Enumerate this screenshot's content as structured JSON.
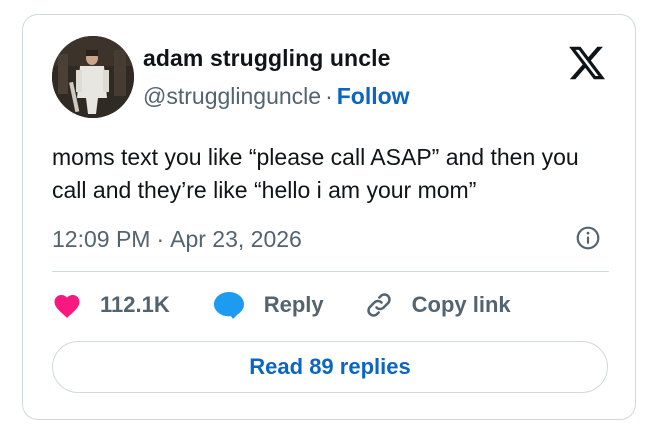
{
  "tweet": {
    "author_name": "adam struggling uncle",
    "author_handle": "@strugglinguncle",
    "separator": "·",
    "follow_label": "Follow",
    "text": "moms text you like “please call ASAP” and then you call and they’re like “hello i am your mom”",
    "time": "12:09 PM",
    "date": "Apr 23, 2026",
    "likes_count": "112.1K",
    "reply_label": "Reply",
    "copy_link_label": "Copy link",
    "read_replies_label": "Read 89 replies"
  },
  "icons": {
    "platform": "x-logo-icon",
    "info": "info-icon",
    "like": "heart-icon",
    "reply": "speech-bubble-icon",
    "copy": "link-icon"
  },
  "colors": {
    "link_blue": "#0a66c2",
    "heart": "#f91880",
    "bubble": "#1d9bf0",
    "muted": "#536471",
    "border": "#cfd9de"
  }
}
